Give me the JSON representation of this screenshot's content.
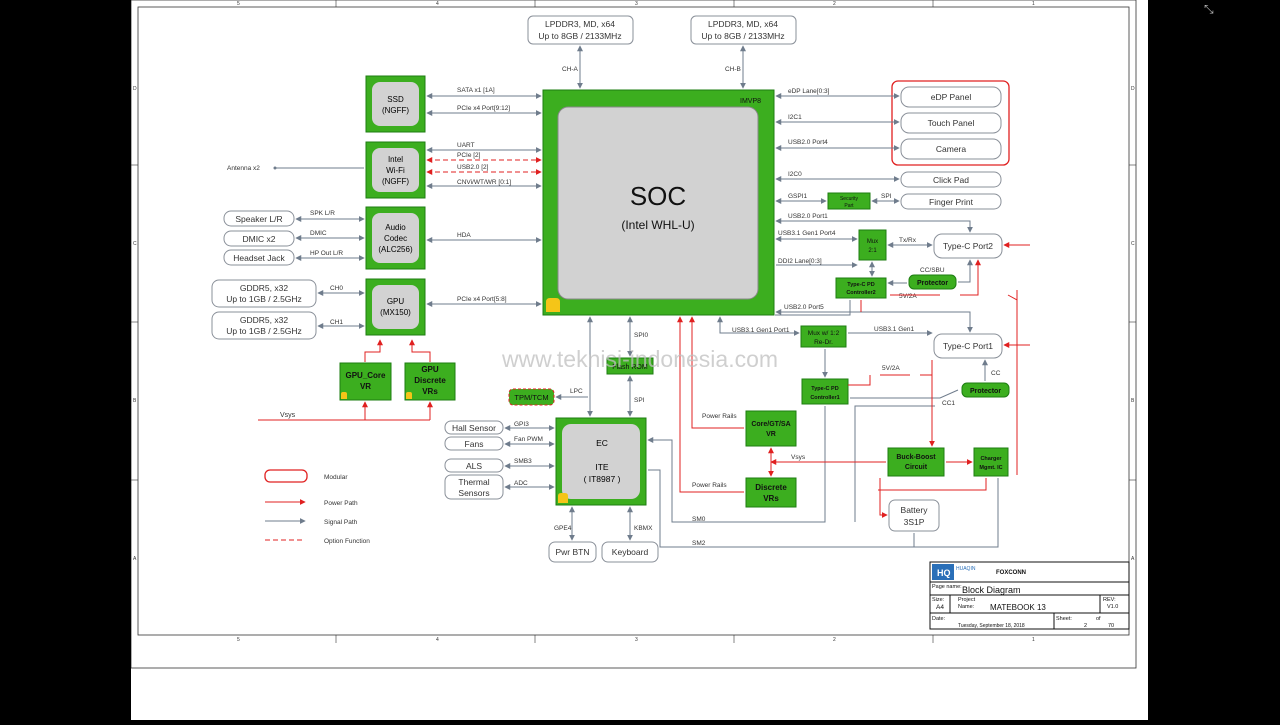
{
  "soc": {
    "title": "SOC",
    "subtitle": "(Intel WHL-U)",
    "imvp": "IMVP8"
  },
  "memory": [
    {
      "line1": "LPDDR3, MD, x64",
      "line2": "Up to 8GB / 2133MHz",
      "channel": "CH-A"
    },
    {
      "line1": "LPDDR3, MD, x64",
      "line2": "Up to 8GB / 2133MHz",
      "channel": "CH-B"
    }
  ],
  "left_blocks": {
    "ssd": {
      "line1": "SSD",
      "line2": "(NGFF)"
    },
    "wifi": {
      "line1": "Intel",
      "line2": "Wi-Fi",
      "line3": "(NGFF)"
    },
    "audio": {
      "line1": "Audio",
      "line2": "Codec",
      "line3": "(ALC256)"
    },
    "gpu": {
      "line1": "GPU",
      "line2": "(MX150)"
    }
  },
  "left_signals": {
    "sata": "SATA x1 [1A]",
    "pcie_ssd": "PCIe x4 Port[9:12]",
    "uart": "UART",
    "pcie2": "PCIe [2]",
    "usb2_2": "USB2.0 [2]",
    "cnv": "CNVi/WT/WR [0:1]",
    "hda": "HDA",
    "pcie_gpu": "PCIe x4 Port[5:8]",
    "antenna": "Antenna x2",
    "spk": "SPK L/R",
    "dmic": "DMIC",
    "hp": "HP Out L/R",
    "ch0": "CH0",
    "ch1": "CH1"
  },
  "audio_devices": [
    "Speaker L/R",
    "DMIC x2",
    "Headset Jack"
  ],
  "gddr": [
    {
      "line1": "GDDR5, x32",
      "line2": "Up to 1GB / 2.5GHz"
    },
    {
      "line1": "GDDR5, x32",
      "line2": "Up to 1GB / 2.5GHz"
    }
  ],
  "gpu_vr": {
    "core_line1": "GPU_Core",
    "core_line2": "VR",
    "disc_line1": "GPU",
    "disc_line2": "Discrete",
    "disc_line3": "VRs",
    "vsys": "Vsys"
  },
  "right_signals": {
    "edp": "eDP Lane[0:3]",
    "i2c1": "I2C1",
    "usb4": "USB2.0 Port4",
    "i2c0": "I2C0",
    "gspi1": "GSPI1",
    "spi": "SPI",
    "usb1": "USB2.0 Port1",
    "usb31p4": "USB3.1 Gen1 Port4",
    "ddi2": "DDI2 Lane[0:3]",
    "txrx": "Tx/Rx",
    "ccsbu": "CC/SBU",
    "v5_2a_a": "5V/2A",
    "usb5": "USB2.0 Port5",
    "usb31p1": "USB3.1 Gen1 Port1",
    "usb31g1": "USB3.1 Gen1",
    "v5_2a_b": "5V/2A",
    "cc": "CC",
    "cc1": "CC1",
    "vsys": "Vsys",
    "power_rails_a": "Power Rails",
    "power_rails_b": "Power Rails",
    "smo": "SM0",
    "sm2": "SM2",
    "spi0": "SPI0",
    "spi_ec": "SPI",
    "lpc": "LPC"
  },
  "right_devices": {
    "edp": "eDP Panel",
    "touch": "Touch Panel",
    "camera": "Camera",
    "clickpad": "Click Pad",
    "finger": "Finger Print",
    "typec2": "Type-C Port2",
    "typec1": "Type-C Port1",
    "battery_line1": "Battery",
    "battery_line2": "3S1P"
  },
  "small_blocks": {
    "security": "Security",
    "security2": "Part",
    "mux_a": "Mux",
    "mux_b": "2:1",
    "pd2_a": "Type-C PD",
    "pd2_b": "Controller2",
    "protector": "Protector",
    "mux_redr_a": "Mux w/ 1:2",
    "mux_redr_b": "Re-Dr.",
    "pd1_a": "Type-C PD",
    "pd1_b": "Controller1",
    "core_gt_sa_1": "Core/GT/SA",
    "core_gt_sa_2": "VR",
    "disc_1": "Discrete",
    "disc_2": "VRs",
    "buck1": "Buck-Boost",
    "buck2": "Circuit",
    "charger1": "Charger",
    "charger2": "Mgmt. IC",
    "flash": "Flash ROM",
    "tpm": "TPM/TCM"
  },
  "ec": {
    "line1": "EC",
    "line2": "ITE",
    "line3": "( IT8987 )"
  },
  "ec_signals": {
    "gpi3": "GPI3",
    "fanpwm": "Fan PWM",
    "smb3": "SMB3",
    "adc": "ADC",
    "gpe4": "GPE4",
    "kbmx": "KBMX"
  },
  "ec_devices": {
    "hall": "Hall Sensor",
    "fans": "Fans",
    "als": "ALS",
    "thermal1": "Thermal",
    "thermal2": "Sensors",
    "pwr": "Pwr BTN",
    "kbd": "Keyboard"
  },
  "legend": {
    "modular": "Modular",
    "power": "Power Path",
    "signal": "Signal Path",
    "option": "Option Function"
  },
  "watermark": "www.teknisi-indonesia.com",
  "title_block": {
    "logo_name": "HUAQIN",
    "company": "FOXCONN",
    "page_name_label": "Page  name:",
    "page_name": "Block Diagram",
    "size_label": "Size:",
    "size": "A4",
    "project_label": "Project",
    "name_label": "Name:",
    "project": "MATEBOOK  13",
    "rev_label": "REV:",
    "rev": "V1.0",
    "date_label": "Date:",
    "date": "Tuesday, September 18, 2018",
    "sheet_label": "Sheet:",
    "sheet": "2",
    "of_label": "of",
    "total": "70"
  },
  "border_marks": {
    "cols": [
      "5",
      "4",
      "3",
      "2",
      "1"
    ],
    "rows": [
      "D",
      "C",
      "B",
      "A"
    ]
  },
  "colors": {
    "green": "#3cae1f",
    "green_border": "#1e7d12",
    "power": "#e02020",
    "signal": "#6f7c8c",
    "box_border": "#8a9099",
    "soc_inner": "#d2d2d2"
  }
}
